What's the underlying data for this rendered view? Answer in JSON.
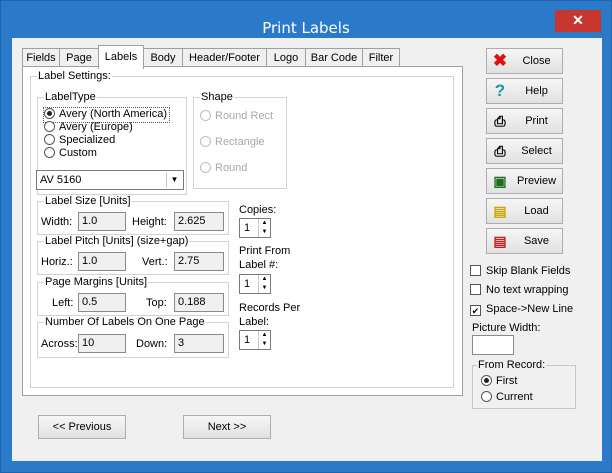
{
  "window": {
    "title": "Print Labels",
    "close_glyph": "✕"
  },
  "tabs": [
    "Fields",
    "Page",
    "Labels",
    "Body",
    "Header/Footer",
    "Logo",
    "Bar Code",
    "Filter"
  ],
  "label_settings": {
    "group_title": "Label Settings:",
    "label_type": {
      "title": "LabelType",
      "options": [
        "Avery (North America)",
        "Avery (Europe)",
        "Specialized",
        "Custom"
      ],
      "selected_index": 0,
      "dropdown_value": "AV 5160"
    },
    "shape": {
      "title": "Shape",
      "options": [
        "Round Rect",
        "Rectangle",
        "Round"
      ],
      "selected_index": 0,
      "disabled": true
    },
    "label_size": {
      "title": "Label Size [Units]",
      "width_label": "Width:",
      "width": "1.0",
      "height_label": "Height:",
      "height": "2.625"
    },
    "label_pitch": {
      "title": "Label Pitch [Units] (size+gap)",
      "horiz_label": "Horiz.:",
      "horiz": "1.0",
      "vert_label": "Vert.:",
      "vert": "2.75"
    },
    "page_margins": {
      "title": "Page Margins [Units]",
      "left_label": "Left:",
      "left": "0.5",
      "top_label": "Top:",
      "top": "0.188"
    },
    "labels_on_page": {
      "title": "Number Of Labels On One Page",
      "across_label": "Across:",
      "across": "10",
      "down_label": "Down:",
      "down": "3"
    },
    "copies": {
      "label": "Copies:",
      "value": "1"
    },
    "print_from": {
      "label_line1": "Print From",
      "label_line2": "Label #:",
      "value": "1"
    },
    "records_per": {
      "label_line1": "Records Per",
      "label_line2": "Label:",
      "value": "1"
    }
  },
  "side_buttons": [
    {
      "label": "Close",
      "icon": "red-x-icon"
    },
    {
      "label": "Help",
      "icon": "question-icon"
    },
    {
      "label": "Print",
      "icon": "printer-icon"
    },
    {
      "label": "Select",
      "icon": "printer-select-icon"
    },
    {
      "label": "Preview",
      "icon": "monitor-icon"
    },
    {
      "label": "Load",
      "icon": "load-icon"
    },
    {
      "label": "Save",
      "icon": "save-icon"
    }
  ],
  "options": {
    "skip_blank": {
      "label": "Skip Blank Fields",
      "checked": false
    },
    "no_wrap": {
      "label": "No text wrapping",
      "checked": false
    },
    "space_newline": {
      "label": "Space->New Line",
      "checked": true
    },
    "picture_width_label": "Picture Width:",
    "picture_width_value": ""
  },
  "from_record": {
    "title": "From Record:",
    "options": [
      "First",
      "Current"
    ],
    "selected_index": 0
  },
  "nav": {
    "previous": "<< Previous",
    "next": "Next >>"
  },
  "colors": {
    "title_bar": "#2b7ac9",
    "close_button": "#c7372f"
  }
}
